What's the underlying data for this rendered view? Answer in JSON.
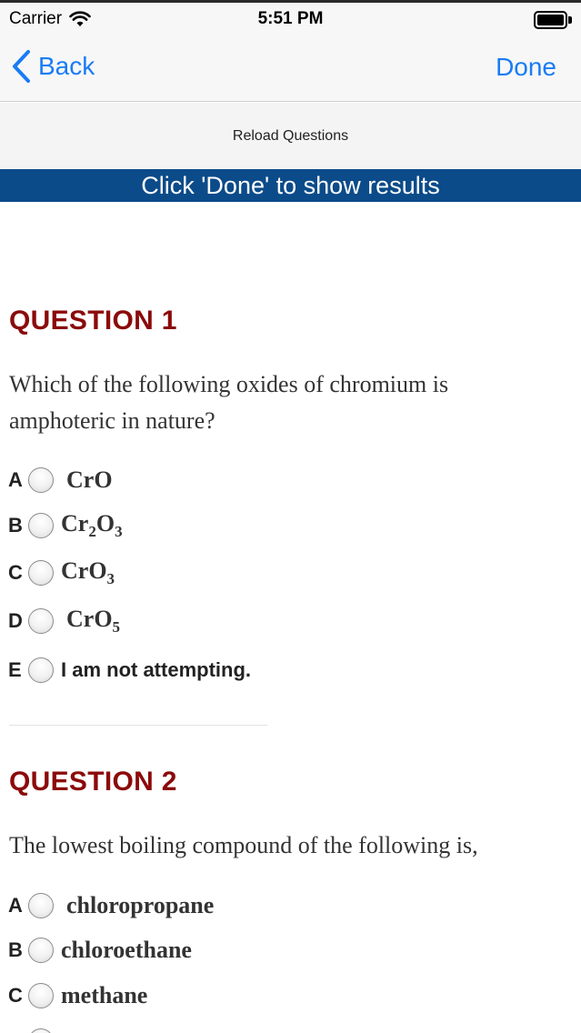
{
  "status_bar": {
    "carrier": "Carrier",
    "time": "5:51 PM"
  },
  "nav": {
    "back_label": "Back",
    "done_label": "Done"
  },
  "reload_label": "Reload Questions",
  "banner_text": "Click 'Done' to show results",
  "questions": [
    {
      "title": "QUESTION 1",
      "text": "Which of the following oxides of chromium is amphoteric in nature?",
      "options": [
        {
          "letter": "A",
          "text": "CrO"
        },
        {
          "letter": "B",
          "text": "Cr",
          "sub1": "2",
          "mid": "O",
          "sub2": "3"
        },
        {
          "letter": "C",
          "text": "CrO",
          "sub1": "3"
        },
        {
          "letter": "D",
          "text": "CrO",
          "sub1": "5"
        },
        {
          "letter": "E",
          "text": "I am not attempting."
        }
      ]
    },
    {
      "title": "QUESTION 2",
      "text": "The lowest boiling compound of the following is,",
      "options": [
        {
          "letter": "A",
          "text": "chloropropane"
        },
        {
          "letter": "B",
          "text": "chloroethane"
        },
        {
          "letter": "C",
          "text": "methane"
        }
      ]
    }
  ]
}
